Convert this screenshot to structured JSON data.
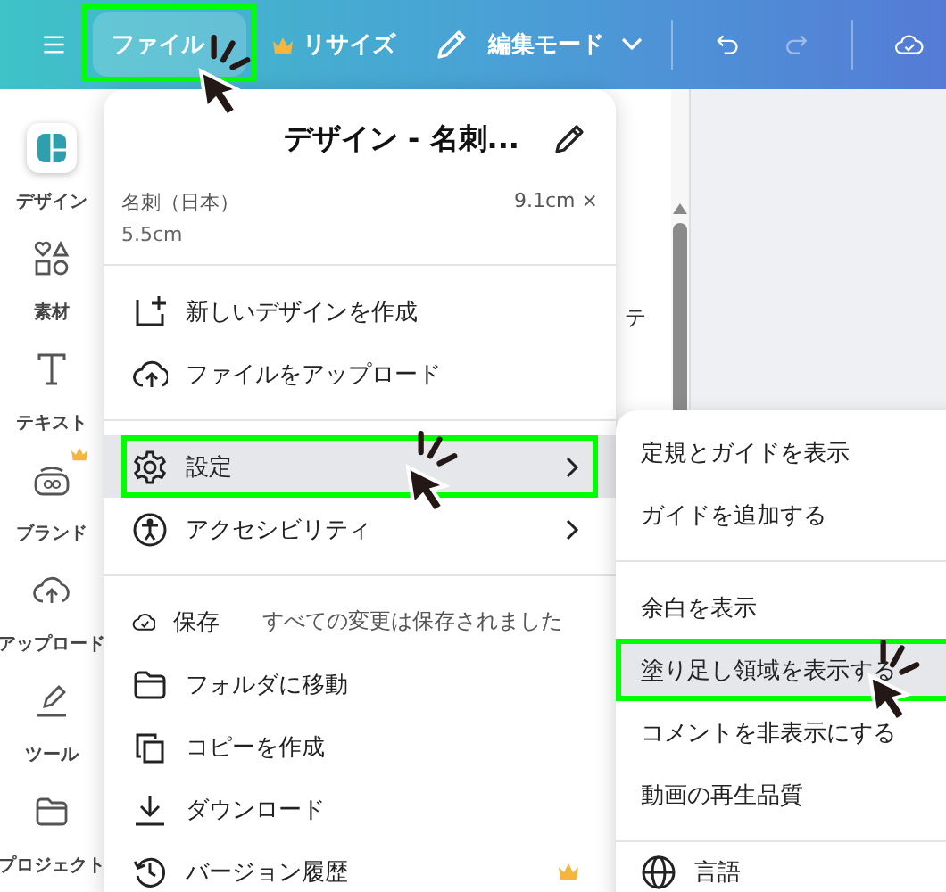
{
  "topbar": {
    "file_button": {
      "label": "ファイル",
      "highlighted": true,
      "pointer": true
    },
    "resize_button": {
      "label": "リサイズ",
      "premium": true
    },
    "edit_mode_button": {
      "label": "編集モード"
    }
  },
  "sidebar": {
    "items": [
      {
        "label": "デザイン",
        "kind": "design",
        "premium": false,
        "selected": true
      },
      {
        "label": "素材",
        "kind": "elements",
        "premium": false,
        "selected": false
      },
      {
        "label": "テキスト",
        "kind": "text",
        "premium": false,
        "selected": false
      },
      {
        "label": "ブランド",
        "kind": "brand",
        "premium": true,
        "selected": false
      },
      {
        "label": "アップロード",
        "kind": "upload",
        "premium": false,
        "selected": false
      },
      {
        "label": "ツール",
        "kind": "tools",
        "premium": false,
        "selected": false
      },
      {
        "label": "プロジェクト",
        "kind": "folder",
        "premium": false,
        "selected": false
      }
    ]
  },
  "side_panel": {
    "text": "テ"
  },
  "file_menu": {
    "title": "デザイン - 名刺...",
    "size_name": "名刺（日本）",
    "size_width": "9.1cm ×",
    "size_height": "5.5cm",
    "groups": [
      [
        {
          "label": "新しいデザインを作成",
          "kind": "new",
          "submenu": false,
          "premium": false,
          "selected": false,
          "highlighted": false,
          "pointer": false
        },
        {
          "label": "ファイルをアップロード",
          "kind": "upload",
          "submenu": false,
          "premium": false,
          "selected": false,
          "highlighted": false,
          "pointer": false
        }
      ],
      [
        {
          "label": "設定",
          "kind": "gear",
          "submenu": true,
          "premium": false,
          "selected": true,
          "highlighted": true,
          "pointer": true
        },
        {
          "label": "アクセシビリティ",
          "kind": "accessibility",
          "submenu": true,
          "premium": false,
          "selected": false,
          "highlighted": false,
          "pointer": false
        }
      ],
      [
        {
          "label": "保存",
          "kind": "save",
          "note": "すべての変更は保存されました",
          "submenu": false,
          "premium": false,
          "selected": false,
          "highlighted": false,
          "pointer": false
        },
        {
          "label": "フォルダに移動",
          "kind": "folder",
          "submenu": false,
          "premium": false,
          "selected": false,
          "highlighted": false,
          "pointer": false
        },
        {
          "label": "コピーを作成",
          "kind": "copy",
          "submenu": false,
          "premium": false,
          "selected": false,
          "highlighted": false,
          "pointer": false
        },
        {
          "label": "ダウンロード",
          "kind": "download",
          "submenu": false,
          "premium": false,
          "selected": false,
          "highlighted": false,
          "pointer": false
        },
        {
          "label": "バージョン履歴",
          "kind": "history",
          "submenu": false,
          "premium": true,
          "selected": false,
          "highlighted": false,
          "pointer": false
        }
      ]
    ]
  },
  "settings_submenu": {
    "groups": [
      [
        {
          "label": "定規とガイドを表示",
          "kind": "plain",
          "selected": false,
          "highlighted": false,
          "pointer": false
        },
        {
          "label": "ガイドを追加する",
          "kind": "plain",
          "selected": false,
          "highlighted": false,
          "pointer": false
        }
      ],
      [
        {
          "label": "余白を表示",
          "kind": "plain",
          "selected": false,
          "highlighted": false,
          "pointer": false
        },
        {
          "label": "塗り足し領域を表示する",
          "kind": "plain",
          "selected": true,
          "highlighted": true,
          "pointer": true
        },
        {
          "label": "コメントを非表示にする",
          "kind": "plain",
          "selected": false,
          "highlighted": false,
          "pointer": false
        },
        {
          "label": "動画の再生品質",
          "kind": "plain",
          "selected": false,
          "highlighted": false,
          "pointer": false
        }
      ],
      [
        {
          "label": "言語",
          "kind": "globe",
          "selected": false,
          "highlighted": false,
          "pointer": false
        }
      ]
    ]
  }
}
